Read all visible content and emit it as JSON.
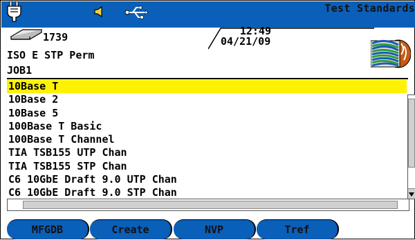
{
  "title": "Test Standards",
  "status": {
    "card_count": "1739",
    "time": "12:49",
    "date": "04/21/09"
  },
  "test_limit": "ISO E STP Perm",
  "job_name": "JOB1",
  "standards_list": [
    "10Base T",
    "10Base 2",
    "10Base 5",
    "100Base T Basic",
    "100Base T Channel",
    "TIA TSB155 UTP Chan",
    "TIA TSB155 STP Chan",
    "C6 10GbE Draft 9.0 UTP Chan",
    "C6 10GbE Draft 9.0 STP Chan"
  ],
  "selected_index": 0,
  "buttons": [
    "MFGDB",
    "Create",
    "NVP",
    "Tref"
  ],
  "colors": {
    "title_bar": "#0a5fb8",
    "selection": "#fff200",
    "button": "#0a5fb8"
  },
  "icons": [
    "power-plug-icon",
    "speaker-icon",
    "usb-icon",
    "memory-card-icon",
    "cable-icon"
  ]
}
